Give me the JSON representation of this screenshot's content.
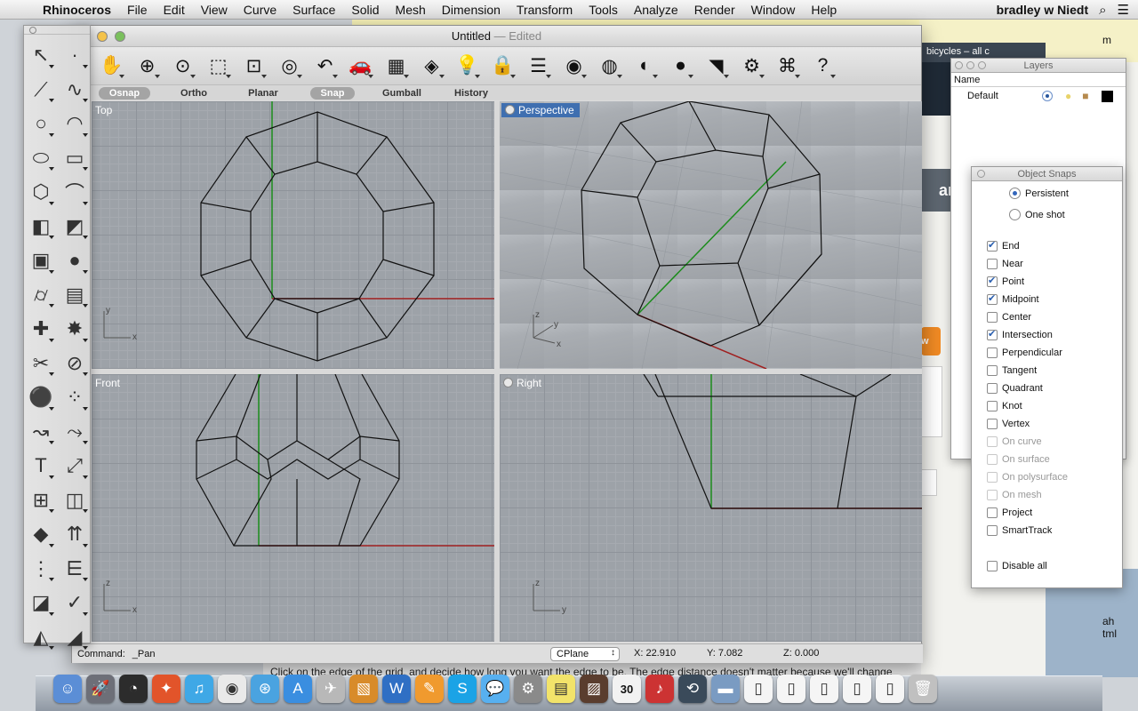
{
  "menubar": {
    "app": "Rhinoceros",
    "items": [
      "File",
      "Edit",
      "View",
      "Curve",
      "Surface",
      "Solid",
      "Mesh",
      "Dimension",
      "Transform",
      "Tools",
      "Analyze",
      "Render",
      "Window",
      "Help"
    ],
    "user": "bradley w Niedt"
  },
  "background": {
    "tab_text": "bicycles – all c",
    "text_top": "m",
    "text_band": "an",
    "text_button": "w",
    "text_bottom": "ah\ntml",
    "status_long": "Click on the edge of the grid, and decide how long you want the edge to be. The edge distance doesn't matter because we'll change"
  },
  "window": {
    "title": "Untitled",
    "title_sep": " — ",
    "title_state": "Edited"
  },
  "toolbar": {
    "icons": [
      "pan-icon",
      "rotate-view-icon",
      "zoom-dynamic-icon",
      "zoom-window-icon",
      "zoom-extents-icon",
      "zoom-selected-icon",
      "undo-view-icon",
      "car-model-icon",
      "grid-plane-icon",
      "snap-object-icon",
      "lightbulb-icon",
      "lock-icon",
      "layer-stack-icon",
      "color-wheel-icon",
      "wireframe-sphere-icon",
      "shaded-sphere-icon",
      "rendered-sphere-icon",
      "spotlight-icon",
      "settings-gear-icon",
      "command-options-icon",
      "help-icon"
    ]
  },
  "modebar": {
    "items": [
      {
        "label": "Osnap",
        "active": true
      },
      {
        "label": "Ortho",
        "active": false
      },
      {
        "label": "Planar",
        "active": false
      },
      {
        "label": "Snap",
        "active": true
      },
      {
        "label": "Gumball",
        "active": false
      },
      {
        "label": "History",
        "active": false
      }
    ]
  },
  "viewports": {
    "top": {
      "label": "Top",
      "axis_a": "y",
      "axis_b": "x"
    },
    "perspective": {
      "label": "Perspective",
      "axis_a": "z",
      "axis_b": "y",
      "axis_c": "x"
    },
    "front": {
      "label": "Front",
      "axis_a": "z",
      "axis_b": "x"
    },
    "right": {
      "label": "Right",
      "axis_a": "z",
      "axis_b": "y"
    }
  },
  "command": {
    "label": "Command:",
    "value": "_Pan",
    "cplane": "CPlane",
    "x": "X: 22.910",
    "y": "Y: 7.082",
    "z": "Z: 0.000"
  },
  "palette": {
    "tools": [
      "select-arrow-icon",
      "point-icon",
      "polyline-icon",
      "curve-icon",
      "circle-icon",
      "arc-icon",
      "ellipse-icon",
      "rectangle-icon",
      "polygon-icon",
      "fillet-curve-icon",
      "surface-icon",
      "surface-edit-icon",
      "box-solid-icon",
      "sphere-solid-icon",
      "cylinder-icon",
      "mesh-surface-icon",
      "puzzle-join-icon",
      "explode-icon",
      "trim-icon",
      "split-icon",
      "boolean-union-icon",
      "point-cloud-icon",
      "curve-offset-icon",
      "curve-tools-icon",
      "text-icon",
      "scale-icon",
      "array-icon",
      "mirror-icon",
      "boolean-solid-icon",
      "extrude-icon",
      "grid-array-icon",
      "align-icon",
      "analysis-icon",
      "check-icon",
      "render-shape-icon",
      "paint-icon"
    ]
  },
  "layers": {
    "title": "Layers",
    "column_name": "Name",
    "rows": [
      {
        "name": "Default",
        "color": "#000000"
      }
    ]
  },
  "osnap": {
    "title": "Object Snaps",
    "modes": [
      {
        "label": "Persistent",
        "on": true
      },
      {
        "label": "One shot",
        "on": false
      }
    ],
    "snaps": [
      {
        "label": "End",
        "on": true,
        "dim": false
      },
      {
        "label": "Near",
        "on": false,
        "dim": false
      },
      {
        "label": "Point",
        "on": true,
        "dim": false
      },
      {
        "label": "Midpoint",
        "on": true,
        "dim": false
      },
      {
        "label": "Center",
        "on": false,
        "dim": false
      },
      {
        "label": "Intersection",
        "on": true,
        "dim": false
      },
      {
        "label": "Perpendicular",
        "on": false,
        "dim": false
      },
      {
        "label": "Tangent",
        "on": false,
        "dim": false
      },
      {
        "label": "Quadrant",
        "on": false,
        "dim": false
      },
      {
        "label": "Knot",
        "on": false,
        "dim": false
      },
      {
        "label": "Vertex",
        "on": false,
        "dim": false
      },
      {
        "label": "On curve",
        "on": false,
        "dim": true
      },
      {
        "label": "On surface",
        "on": false,
        "dim": true
      },
      {
        "label": "On polysurface",
        "on": false,
        "dim": true
      },
      {
        "label": "On mesh",
        "on": false,
        "dim": true
      },
      {
        "label": "Project",
        "on": false,
        "dim": false
      },
      {
        "label": "SmartTrack",
        "on": false,
        "dim": false
      }
    ],
    "disable_all": "Disable all"
  },
  "dock": {
    "icons": [
      "finder-icon",
      "launchpad-icon",
      "dashboard-icon",
      "safari-compass-icon",
      "itunes-icon",
      "chrome-icon",
      "safari-icon",
      "app-store-icon",
      "airplane-icon",
      "preview-icon",
      "word-icon",
      "pages-icon",
      "skype-icon",
      "messages-icon",
      "system-prefs-icon",
      "stickies-icon",
      "photo-icon",
      "calendar-icon",
      "audio-icon",
      "time-machine-icon",
      "folder-icon",
      "document-icon",
      "document2-icon",
      "document3-icon",
      "document4-icon",
      "document5-icon",
      "trash-icon"
    ],
    "calendar_day": "30"
  }
}
